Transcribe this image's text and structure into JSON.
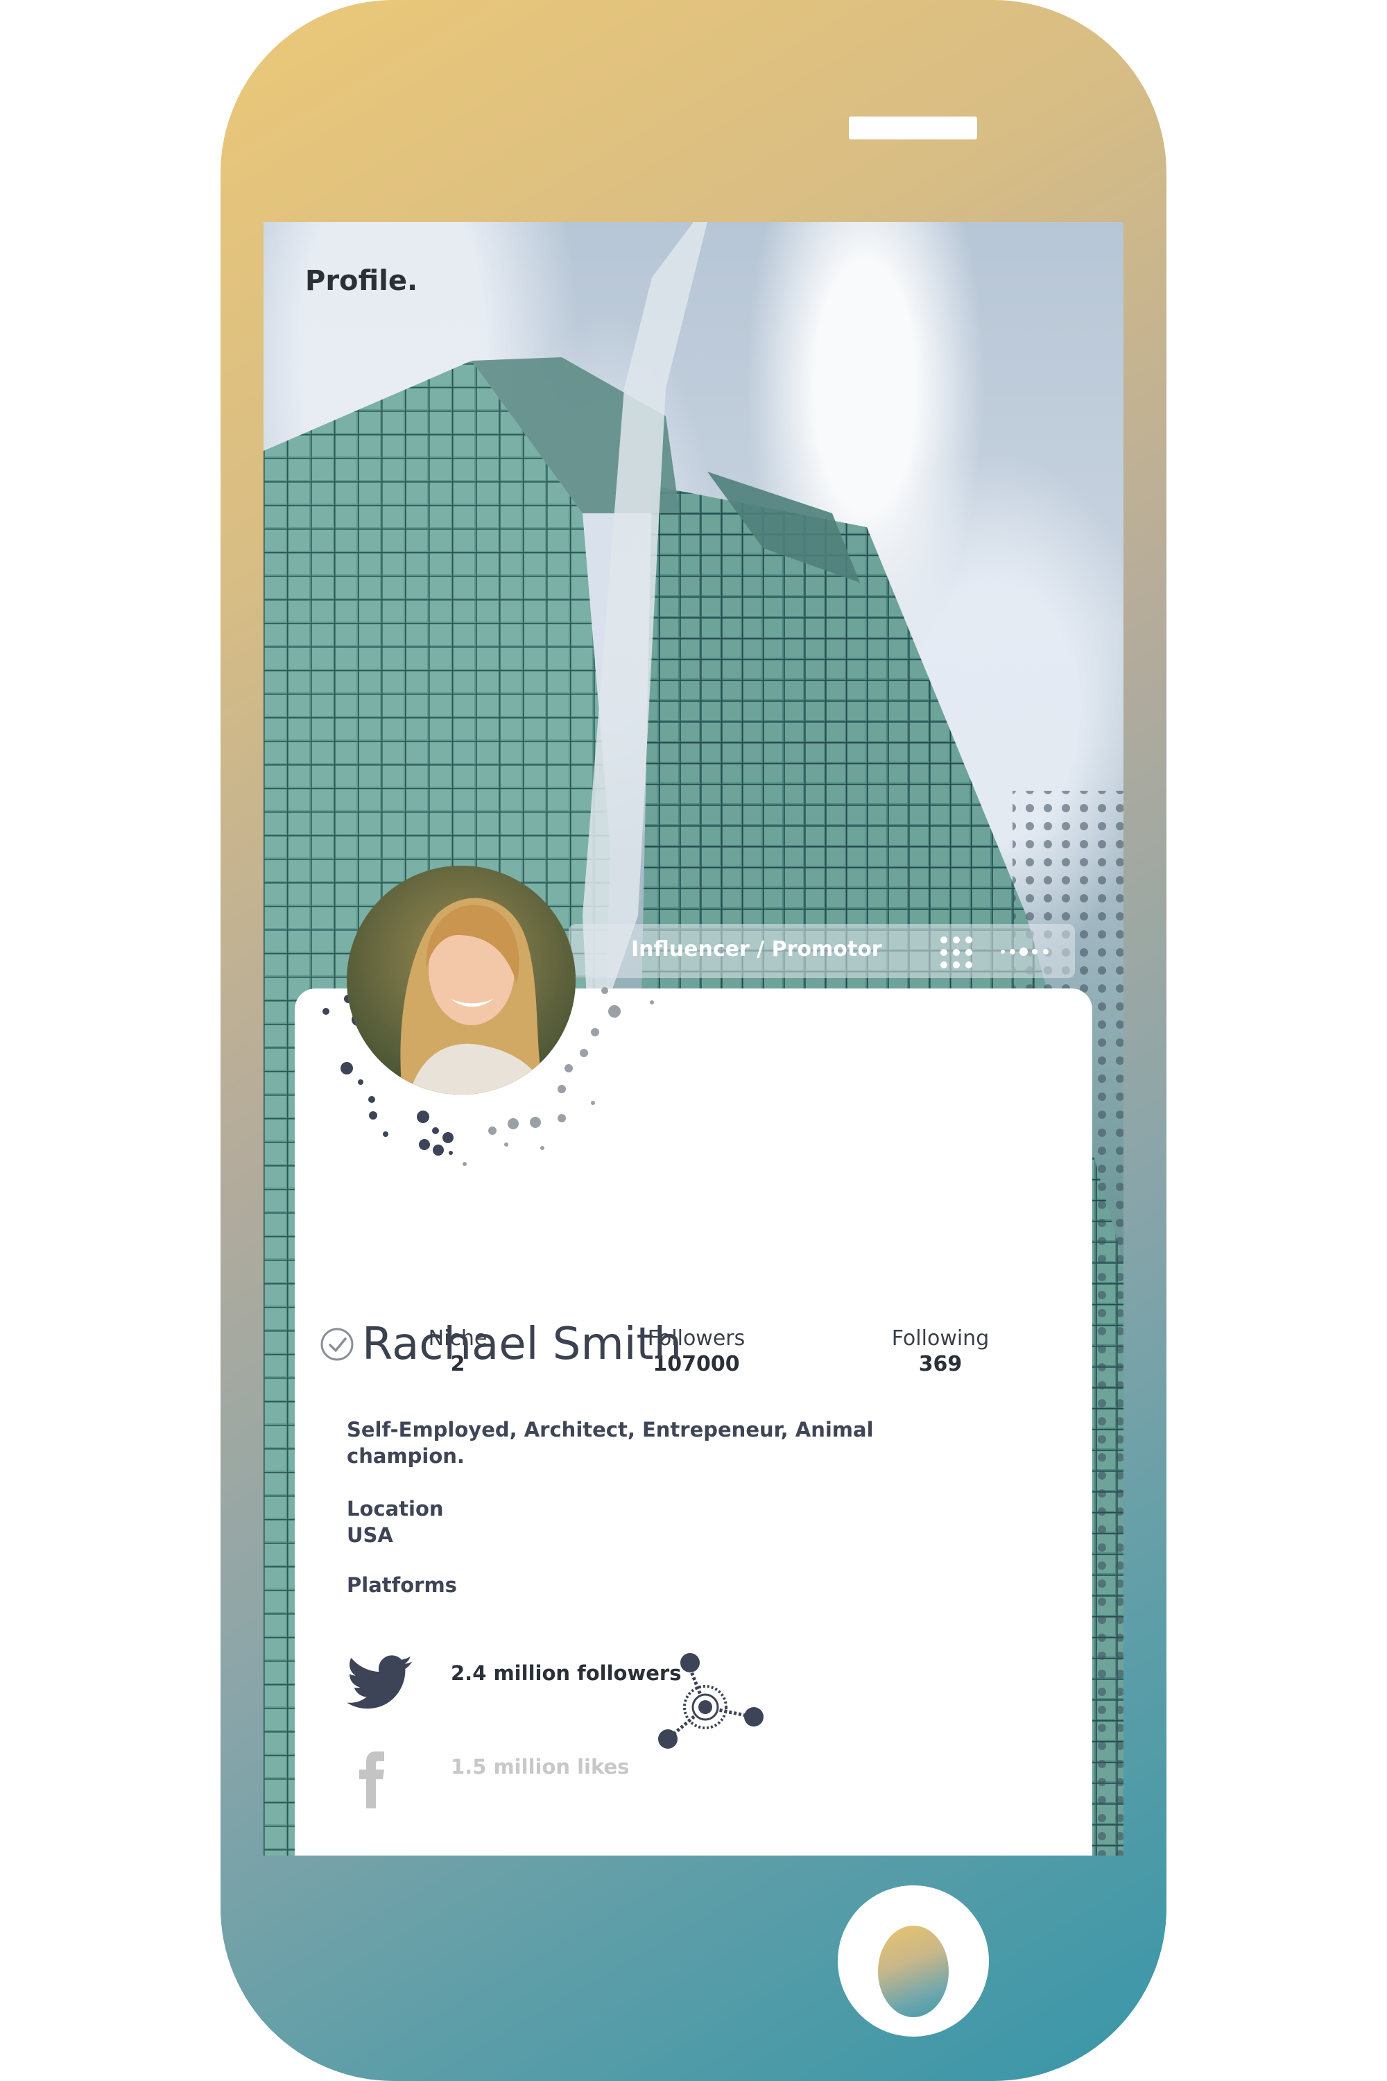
{
  "screen": {
    "title": "Profile.",
    "role_bar": {
      "label": "Influencer / Promotor"
    },
    "stats": [
      {
        "label": "Niche",
        "value": "2"
      },
      {
        "label": "Followers",
        "value": "107000"
      },
      {
        "label": "Following",
        "value": "369"
      }
    ],
    "profile": {
      "name": "Rachael Smith",
      "bio": "Self-Employed, Architect, Entrepeneur, Animal champion.",
      "location_label": "Location",
      "location_value": "USA",
      "platforms_label": "Platforms"
    },
    "platforms": [
      {
        "icon": "twitter-icon",
        "text": "2.4 million followers"
      },
      {
        "icon": "facebook-icon",
        "text": "1.5 million likes"
      }
    ]
  },
  "colors": {
    "phone_gradient_start": "#ebc878",
    "phone_gradient_end": "#3896a8",
    "text_dark": "#3f4556",
    "icon_dark": "#3d4457"
  }
}
